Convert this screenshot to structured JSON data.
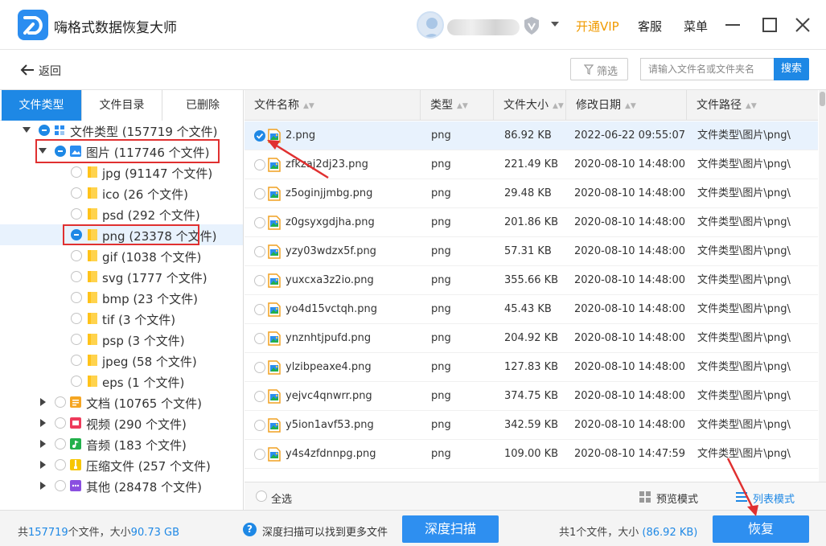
{
  "app": {
    "title": "嗨格式数据恢复大师",
    "vip_label": "开通VIP",
    "service_label": "客服",
    "menu_label": "菜单"
  },
  "toolbar": {
    "back_label": "返回",
    "filter_label": "筛选",
    "search_placeholder": "请输入文件名或文件夹名",
    "search_button": "搜索"
  },
  "tabs": [
    {
      "label": "文件类型"
    },
    {
      "label": "文件目录"
    },
    {
      "label": "已删除"
    }
  ],
  "tree": [
    {
      "label": "文件类型 (157719 个文件)"
    },
    {
      "label": "图片 (117746 个文件)"
    },
    {
      "label": "jpg (91147 个文件)"
    },
    {
      "label": "ico (26 个文件)"
    },
    {
      "label": "psd (292 个文件)"
    },
    {
      "label": "png (23378 个文件)"
    },
    {
      "label": "gif (1038 个文件)"
    },
    {
      "label": "svg (1777 个文件)"
    },
    {
      "label": "bmp (23 个文件)"
    },
    {
      "label": "tif (3 个文件)"
    },
    {
      "label": "psp (3 个文件)"
    },
    {
      "label": "jpeg (58 个文件)"
    },
    {
      "label": "eps (1 个文件)"
    },
    {
      "label": "文档 (10765 个文件)"
    },
    {
      "label": "视频 (290 个文件)"
    },
    {
      "label": "音频 (183 个文件)"
    },
    {
      "label": "压缩文件 (257 个文件)"
    },
    {
      "label": "其他 (28478 个文件)"
    }
  ],
  "columns": {
    "name": "文件名称",
    "type": "类型",
    "size": "文件大小",
    "date": "修改日期",
    "path": "文件路径"
  },
  "files": [
    {
      "name": "2.png",
      "type": "png",
      "size": "86.92 KB",
      "date": "2022-06-22 09:55:07",
      "path": "文件类型\\图片\\png\\"
    },
    {
      "name": "zfkzaj2dj23.png",
      "type": "png",
      "size": "221.49 KB",
      "date": "2020-08-10 14:48:00",
      "path": "文件类型\\图片\\png\\"
    },
    {
      "name": "z5oginjjmbg.png",
      "type": "png",
      "size": "29.48 KB",
      "date": "2020-08-10 14:48:00",
      "path": "文件类型\\图片\\png\\"
    },
    {
      "name": "z0gsyxgdjha.png",
      "type": "png",
      "size": "201.86 KB",
      "date": "2020-08-10 14:48:00",
      "path": "文件类型\\图片\\png\\"
    },
    {
      "name": "yzy03wdzx5f.png",
      "type": "png",
      "size": "57.31 KB",
      "date": "2020-08-10 14:48:00",
      "path": "文件类型\\图片\\png\\"
    },
    {
      "name": "yuxcxa3z2io.png",
      "type": "png",
      "size": "355.66 KB",
      "date": "2020-08-10 14:48:00",
      "path": "文件类型\\图片\\png\\"
    },
    {
      "name": "yo4d15vctqh.png",
      "type": "png",
      "size": "45.43 KB",
      "date": "2020-08-10 14:48:00",
      "path": "文件类型\\图片\\png\\"
    },
    {
      "name": "ynznhtjpufd.png",
      "type": "png",
      "size": "204.92 KB",
      "date": "2020-08-10 14:48:00",
      "path": "文件类型\\图片\\png\\"
    },
    {
      "name": "ylzibpeaxe4.png",
      "type": "png",
      "size": "127.83 KB",
      "date": "2020-08-10 14:48:00",
      "path": "文件类型\\图片\\png\\"
    },
    {
      "name": "yejvc4qnwrr.png",
      "type": "png",
      "size": "374.75 KB",
      "date": "2020-08-10 14:48:00",
      "path": "文件类型\\图片\\png\\"
    },
    {
      "name": "y5ion1avf53.png",
      "type": "png",
      "size": "342.59 KB",
      "date": "2020-08-10 14:48:00",
      "path": "文件类型\\图片\\png\\"
    },
    {
      "name": "y4s4zfdnnpg.png",
      "type": "png",
      "size": "109.00 KB",
      "date": "2020-08-10 14:47:59",
      "path": "文件类型\\图片\\png\\"
    }
  ],
  "footer": {
    "select_all": "全选",
    "preview_mode": "预览模式",
    "list_mode": "列表模式"
  },
  "status": {
    "total_prefix": "共",
    "total_count": "157719",
    "total_mid": "个文件，大小",
    "total_size": "90.73 GB",
    "tip": "深度扫描可以找到更多文件",
    "deep_scan": "深度扫描",
    "selected_text": "共1个文件，大小",
    "selected_size": "(86.92 KB)",
    "recover": "恢复"
  },
  "colors": {
    "accent": "#1e88e5",
    "vip": "#f09a00",
    "highlight": "#e03030"
  }
}
